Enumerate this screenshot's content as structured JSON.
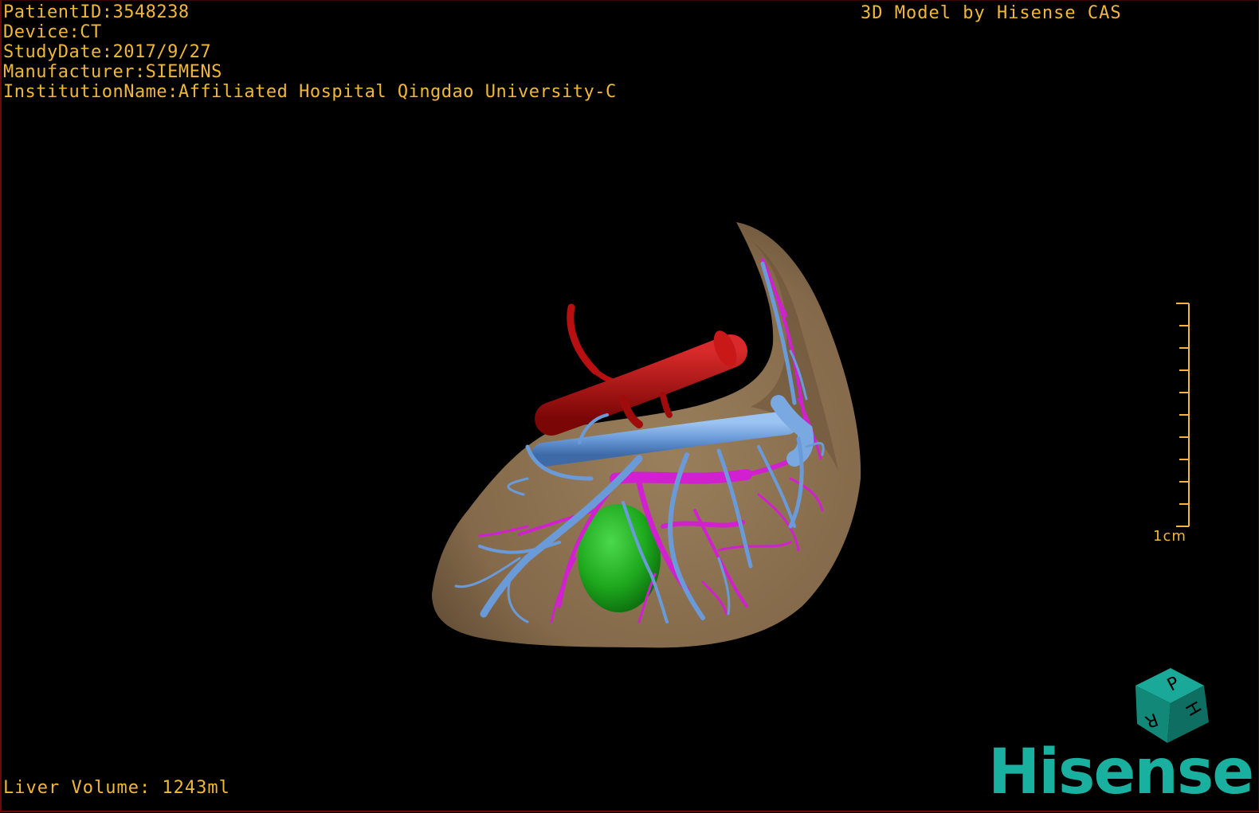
{
  "overlay": {
    "patient_id": "PatientID:3548238",
    "device": "Device:CT",
    "study_date": "StudyDate:2017/9/27",
    "manufacturer": "Manufacturer:SIEMENS",
    "institution": "InstitutionName:Affiliated Hospital Qingdao University-C",
    "credit": "3D Model by Hisense CAS",
    "liver_volume": "Liver Volume: 1243ml"
  },
  "scale": {
    "label": "1cm",
    "ticks": 11
  },
  "orientation_cube": {
    "faces": [
      "P",
      "H",
      "R"
    ]
  },
  "brand": {
    "name": "Hisense"
  },
  "colors": {
    "text": "#f0b838",
    "liver": "#8a7050",
    "hepatic_vein": "#6a9ad8",
    "portal_vein": "#d020d0",
    "artery": "#b81010",
    "tumor": "#1ea81e",
    "brand": "#1ab0a0"
  }
}
